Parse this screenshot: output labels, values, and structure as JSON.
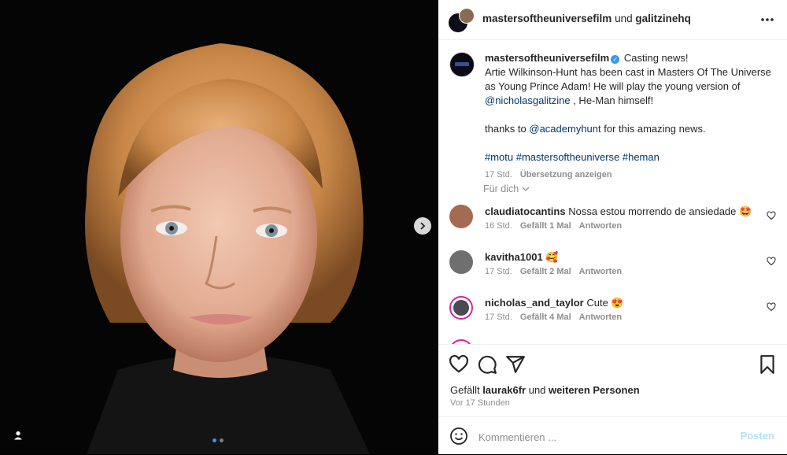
{
  "header": {
    "account": "mastersoftheuniversefilm",
    "connector": " und ",
    "collaborator": "galitzinehq",
    "more_icon": "more-horizontal-icon"
  },
  "caption": {
    "username": "mastersoftheuniversefilm",
    "verified_icon": "verified-badge-icon",
    "line1": " Casting news!",
    "line2": "Artie Wilkinson-Hunt has been cast in Masters Of The Universe as Young Prince Adam! He will play the young version of ",
    "mention1": "@nicholasgalitzine",
    "line3": " , He-Man himself!",
    "thanks_prefix": "thanks to ",
    "mention2": "@academyhunt",
    "thanks_suffix": " for this amazing news.",
    "hashtags": "#motu #mastersoftheuniverse #heman",
    "time": "17 Std.",
    "translate": "Übersetzung anzeigen"
  },
  "for_you": "Für dich",
  "comments": [
    {
      "username": "claudiatocantins",
      "text": "Nossa estou morrendo de ansiedade 🤩",
      "time": "16 Std.",
      "likes": "Gefällt 1 Mal",
      "reply": "Antworten"
    },
    {
      "username": "kavitha1001",
      "text": "🥰",
      "time": "17 Std.",
      "likes": "Gefällt 2 Mal",
      "reply": "Antworten"
    },
    {
      "username": "nicholas_and_taylor",
      "text": "Cute 😍",
      "time": "17 Std.",
      "likes": "Gefällt 4 Mal",
      "reply": "Antworten"
    }
  ],
  "likes": {
    "prefix": "Gefällt ",
    "user": "laurak6fr",
    "middle": " und ",
    "others": "weiteren Personen"
  },
  "posted_ago": "Vor 17 Stunden",
  "comment_box": {
    "placeholder": "Kommentieren ...",
    "post_label": "Posten"
  },
  "colors": {
    "link": "#00376b",
    "accent": "#3897f0",
    "post_disabled": "#b2dffc",
    "muted": "#8e8e8e"
  }
}
